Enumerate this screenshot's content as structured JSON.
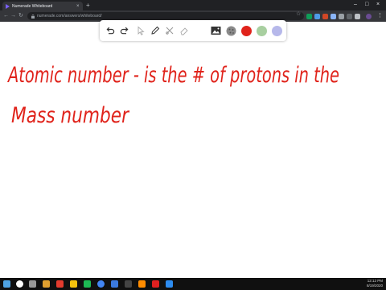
{
  "browser": {
    "tab_title": "Numerade Whiteboard",
    "url": "numerade.com/answers/whiteboard/"
  },
  "whiteboard": {
    "tools": [
      "undo-icon",
      "redo-icon",
      "pointer-icon",
      "pen-icon",
      "tools-icon",
      "eraser-icon",
      "image-icon",
      "texture-icon"
    ],
    "colors": [
      "#e0231b",
      "#a8cfa0",
      "#b6b8ea"
    ],
    "selected_color": "#e0231b",
    "ink_lines": [
      "Atomic number - is the # of protons in the",
      "Mass number"
    ]
  },
  "taskbar": {
    "time": "12:12 PM",
    "date": "8/19/2020"
  }
}
